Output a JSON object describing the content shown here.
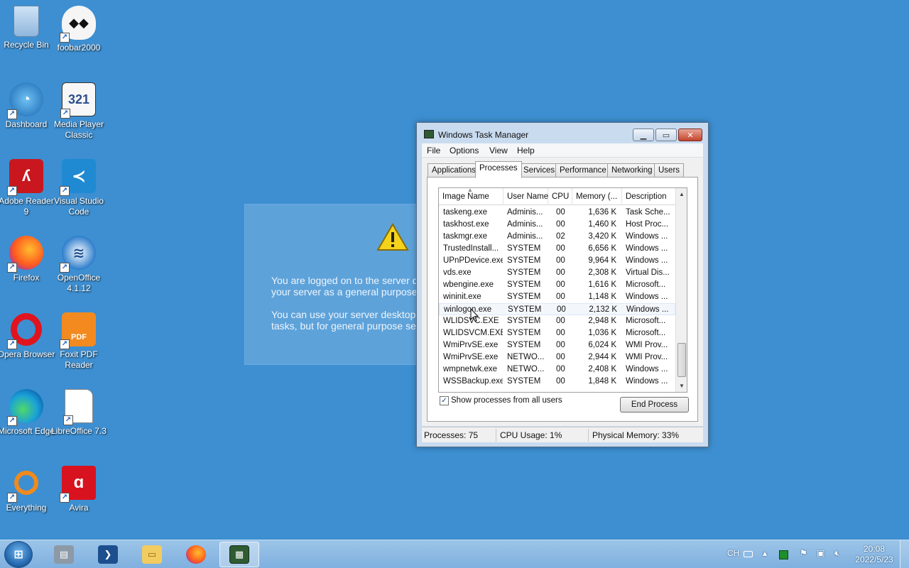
{
  "desktop": {
    "icons": [
      {
        "label": "Recycle Bin",
        "icon": "recycle-bin-icon"
      },
      {
        "label": "foobar2000",
        "icon": "foobar-icon"
      },
      {
        "label": "Dashboard",
        "icon": "dashboard-icon"
      },
      {
        "label": "Media Player Classic",
        "icon": "media-player-icon"
      },
      {
        "label": "Adobe Reader 9",
        "icon": "adobe-reader-icon"
      },
      {
        "label": "Visual Studio Code",
        "icon": "vscode-icon"
      },
      {
        "label": "Firefox",
        "icon": "firefox-icon"
      },
      {
        "label": "OpenOffice 4.1.12",
        "icon": "openoffice-icon"
      },
      {
        "label": "Opera Browser",
        "icon": "opera-icon"
      },
      {
        "label": "Foxit PDF Reader",
        "icon": "foxit-icon"
      },
      {
        "label": "Microsoft Edge",
        "icon": "edge-icon"
      },
      {
        "label": "LibreOffice 7.3",
        "icon": "libreoffice-icon"
      },
      {
        "label": "Everything",
        "icon": "everything-icon"
      },
      {
        "label": "Avira",
        "icon": "avira-icon"
      }
    ]
  },
  "server_dialog": {
    "line1": "You are logged on to the server de",
    "line2": "your server as a general purpose w",
    "line3": "You can use your server desktop to",
    "line4": "tasks, but for general purpose serv"
  },
  "taskmgr": {
    "title": "Windows Task Manager",
    "menu": [
      "File",
      "Options",
      "View",
      "Help"
    ],
    "tabs": [
      "Applications",
      "Processes",
      "Services",
      "Performance",
      "Networking",
      "Users"
    ],
    "active_tab": "Processes",
    "columns": [
      "Image Name",
      "User Name",
      "CPU",
      "Memory (...",
      "Description"
    ],
    "rows": [
      {
        "name": "taskeng.exe",
        "user": "Adminis...",
        "cpu": "00",
        "mem": "1,636 K",
        "desc": "Task Sche..."
      },
      {
        "name": "taskhost.exe",
        "user": "Adminis...",
        "cpu": "00",
        "mem": "1,460 K",
        "desc": "Host Proc..."
      },
      {
        "name": "taskmgr.exe",
        "user": "Adminis...",
        "cpu": "02",
        "mem": "3,420 K",
        "desc": "Windows ..."
      },
      {
        "name": "TrustedInstall...",
        "user": "SYSTEM",
        "cpu": "00",
        "mem": "6,656 K",
        "desc": "Windows ..."
      },
      {
        "name": "UPnPDevice.exe",
        "user": "SYSTEM",
        "cpu": "00",
        "mem": "9,964 K",
        "desc": "Windows ..."
      },
      {
        "name": "vds.exe",
        "user": "SYSTEM",
        "cpu": "00",
        "mem": "2,308 K",
        "desc": "Virtual Dis..."
      },
      {
        "name": "wbengine.exe",
        "user": "SYSTEM",
        "cpu": "00",
        "mem": "1,616 K",
        "desc": "Microsoft..."
      },
      {
        "name": "wininit.exe",
        "user": "SYSTEM",
        "cpu": "00",
        "mem": "1,148 K",
        "desc": "Windows ..."
      },
      {
        "name": "winlogon.exe",
        "user": "SYSTEM",
        "cpu": "00",
        "mem": "2,132 K",
        "desc": "Windows ..."
      },
      {
        "name": "WLIDSVC.EXE",
        "user": "SYSTEM",
        "cpu": "00",
        "mem": "2,948 K",
        "desc": "Microsoft..."
      },
      {
        "name": "WLIDSVCM.EXE",
        "user": "SYSTEM",
        "cpu": "00",
        "mem": "1,036 K",
        "desc": "Microsoft..."
      },
      {
        "name": "WmiPrvSE.exe",
        "user": "SYSTEM",
        "cpu": "00",
        "mem": "6,024 K",
        "desc": "WMI Prov..."
      },
      {
        "name": "WmiPrvSE.exe",
        "user": "NETWO...",
        "cpu": "00",
        "mem": "2,944 K",
        "desc": "WMI Prov..."
      },
      {
        "name": "wmpnetwk.exe",
        "user": "NETWO...",
        "cpu": "00",
        "mem": "2,408 K",
        "desc": "Windows ..."
      },
      {
        "name": "WSSBackup.exe",
        "user": "SYSTEM",
        "cpu": "00",
        "mem": "1,848 K",
        "desc": "Windows ..."
      }
    ],
    "show_all_label": "Show processes from all users",
    "show_all_checked": true,
    "end_process_label": "End Process",
    "status": {
      "processes": "Processes: 75",
      "cpu": "CPU Usage: 1%",
      "memory": "Physical Memory: 33%"
    }
  },
  "taskbar": {
    "apps": [
      "server-manager-icon",
      "powershell-icon",
      "explorer-icon",
      "firefox-icon",
      "task-manager-icon"
    ],
    "tray": {
      "lang": "CH",
      "time": "20:08",
      "date": "2022/5/23"
    }
  },
  "colors": {
    "desktop": "#3d8fd1",
    "window_frame": "#c9dbef",
    "close_button": "#c4442b"
  }
}
